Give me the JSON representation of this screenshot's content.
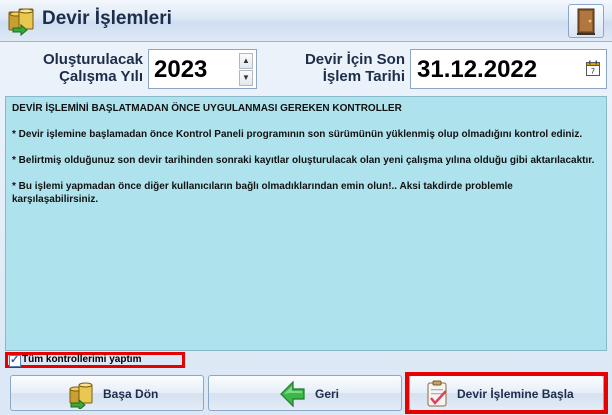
{
  "window": {
    "title": "Devir İşlemleri",
    "icons": {
      "title": "money-transfer-icon",
      "exit": "exit-door-icon"
    }
  },
  "params": {
    "year_label_line1": "Oluşturulacak",
    "year_label_line2": "Çalışma Yılı",
    "year_value": "2023",
    "date_label_line1": "Devir İçin Son",
    "date_label_line2": "İşlem Tarihi",
    "date_value": "31.12.2022",
    "date_icon": "calendar-icon"
  },
  "info": {
    "heading": "DEVİR İŞLEMİNİ BAŞLATMADAN ÖNCE UYGULANMASI GEREKEN KONTROLLER",
    "items": [
      "* Devir işlemine başlamadan önce Kontrol Paneli programının son sürümünün yüklenmiş olup olmadığını kontrol ediniz.",
      "* Belirtmiş olduğunuz son devir tarihinden sonraki kayıtlar oluşturulacak olan yeni çalışma yılına olduğu gibi aktarılacaktır.",
      "* Bu işlemi yapmadan önce diğer kullanıcıların bağlı olmadıklarından emin olun!.. Aksi takdirde problemle karşılaşabilirsiniz."
    ]
  },
  "confirm": {
    "label": "Tüm kontrollerimi yaptım",
    "checked": true
  },
  "buttons": {
    "home": {
      "label": "Başa Dön",
      "icon": "coins-home-icon"
    },
    "back": {
      "label": "Geri",
      "icon": "green-arrow-left-icon"
    },
    "start": {
      "label": "Devir İşlemine Başla",
      "icon": "clipboard-check-icon"
    }
  },
  "colors": {
    "info_bg": "#aee3ee",
    "highlight": "#e60000",
    "window_bg": "#dbe7f5"
  }
}
